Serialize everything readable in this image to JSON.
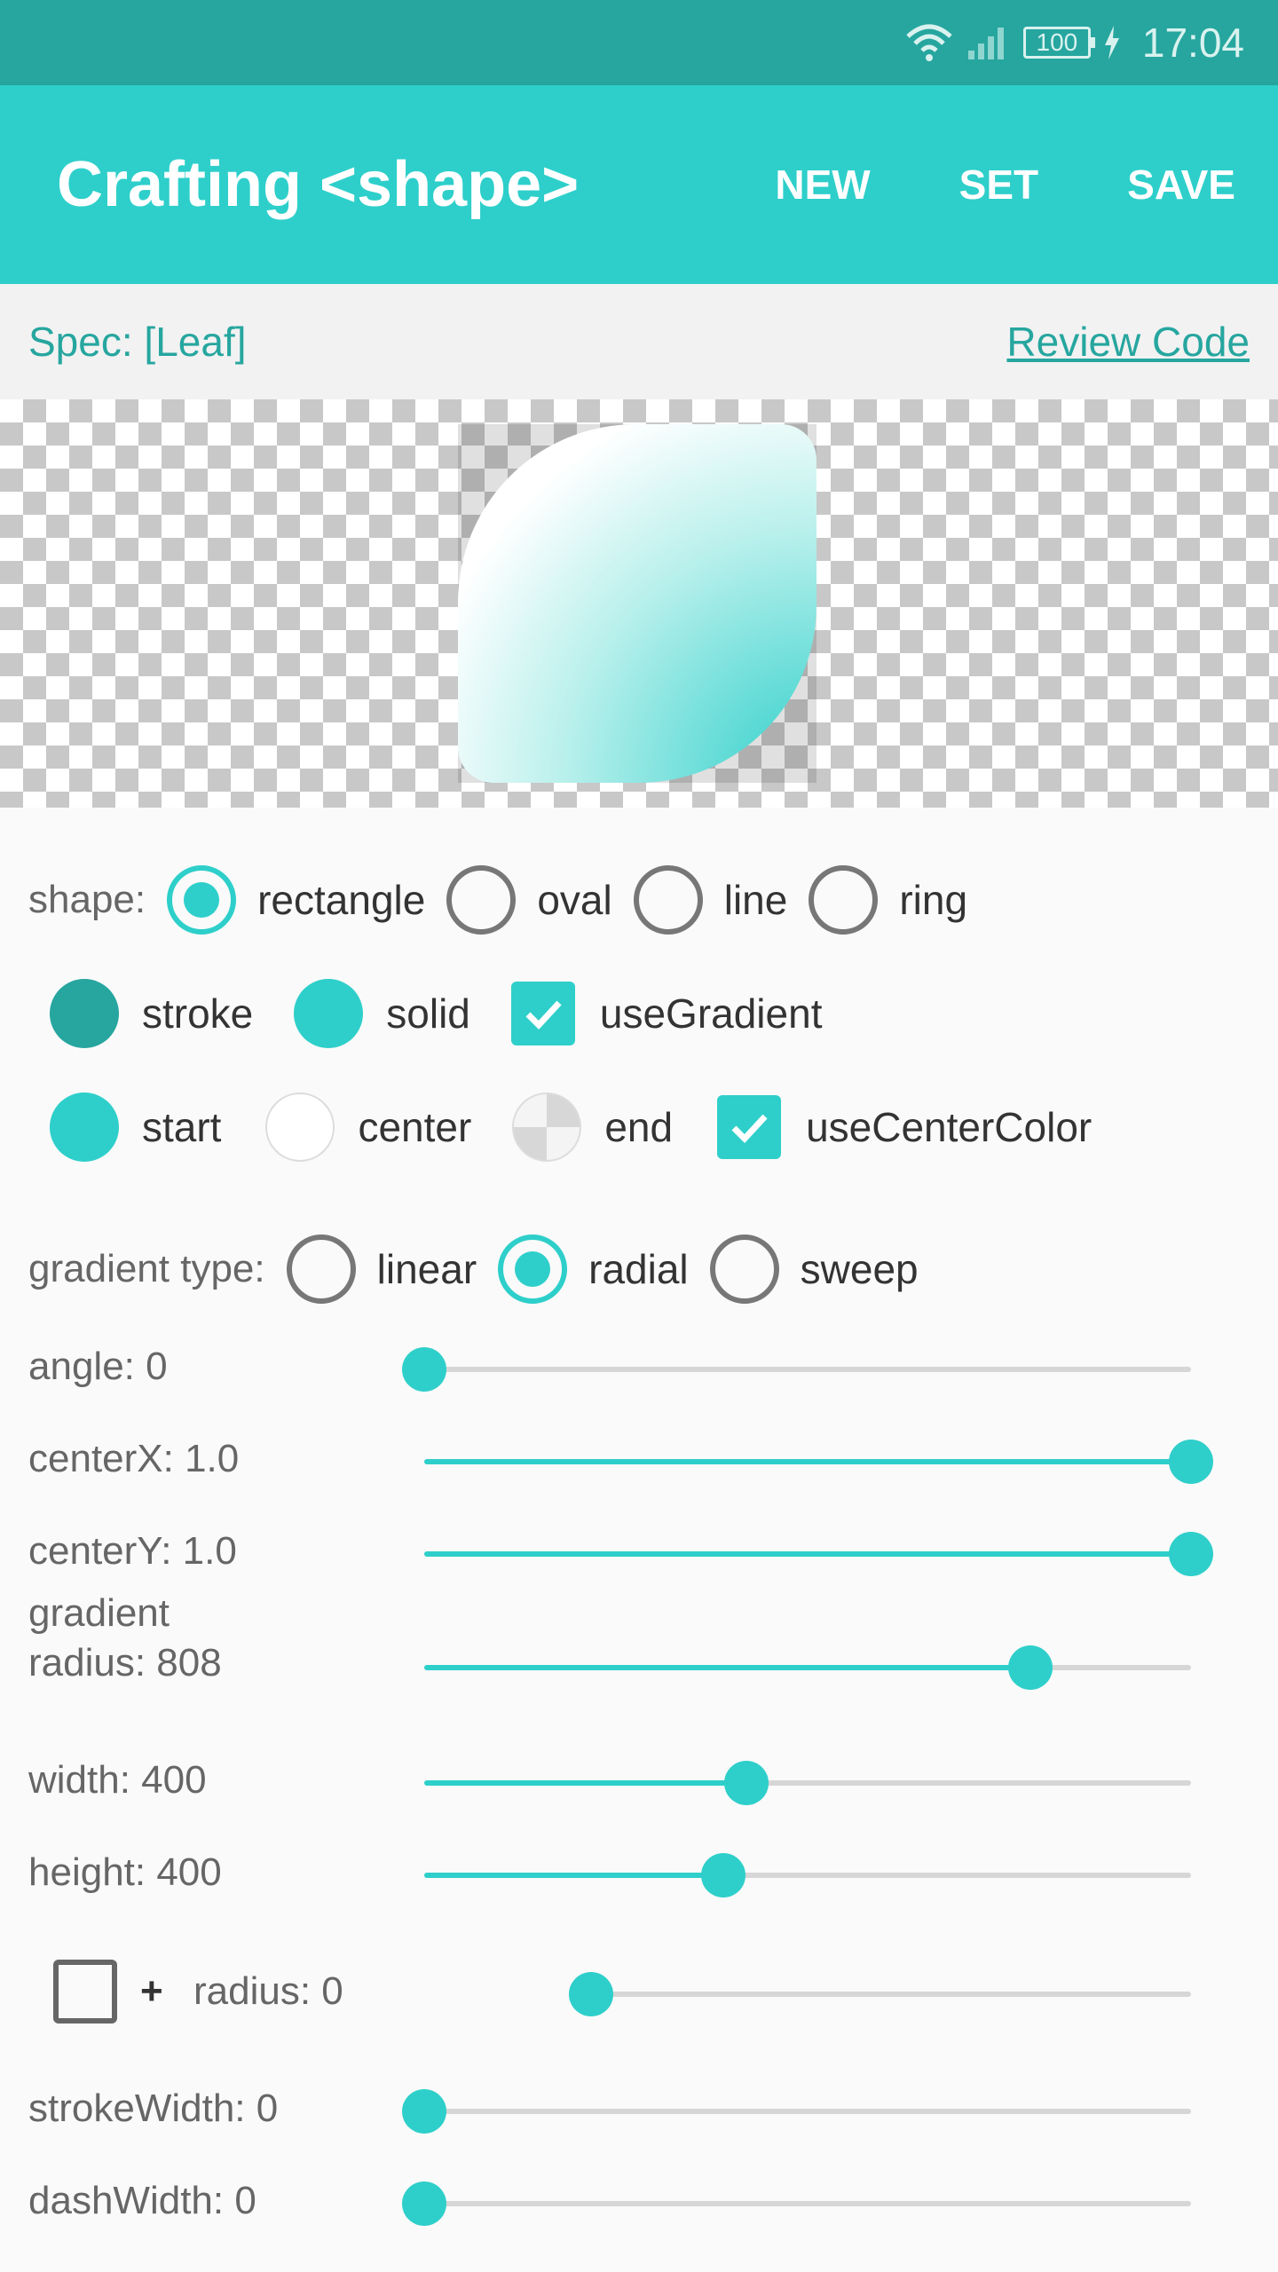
{
  "status": {
    "time": "17:04",
    "battery": "100"
  },
  "appbar": {
    "title": "Crafting <shape>",
    "actions": [
      "NEW",
      "SET",
      "SAVE"
    ]
  },
  "spec": {
    "label": "Spec: [Leaf]",
    "review_link": "Review Code"
  },
  "colors": {
    "accent": "#2ecfca",
    "dark_accent": "#26a69f"
  },
  "shape_row": {
    "label": "shape:",
    "options": [
      {
        "label": "rectangle",
        "selected": true
      },
      {
        "label": "oval",
        "selected": false
      },
      {
        "label": "line",
        "selected": false
      },
      {
        "label": "ring",
        "selected": false
      }
    ]
  },
  "fill_row": {
    "stroke": "stroke",
    "solid": "solid",
    "use_gradient": "useGradient",
    "use_gradient_checked": true
  },
  "color_row": {
    "start": "start",
    "center": "center",
    "end": "end",
    "use_center_color": "useCenterColor",
    "use_center_color_checked": true
  },
  "gradient_type": {
    "label": "gradient type:",
    "options": [
      {
        "label": "linear",
        "selected": false
      },
      {
        "label": "radial",
        "selected": true
      },
      {
        "label": "sweep",
        "selected": false
      }
    ]
  },
  "sliders": {
    "angle": {
      "label": "angle: 0",
      "value": 0
    },
    "center_x": {
      "label": "centerX: 1.0",
      "value": 1.0
    },
    "center_y": {
      "label": "centerY: 1.0",
      "value": 1.0
    },
    "gradient_radius": {
      "label_line1": "gradient",
      "label_line2": "radius: 808",
      "value": 0.79
    },
    "width": {
      "label": "width: 400",
      "value": 0.42
    },
    "height": {
      "label": "height: 400",
      "value": 0.39
    },
    "radius": {
      "plus": "+",
      "label": "radius: 0",
      "value": 0,
      "checked": false
    },
    "stroke_width": {
      "label": "strokeWidth: 0",
      "value": 0
    },
    "dash_width": {
      "label": "dashWidth: 0",
      "value": 0
    }
  }
}
